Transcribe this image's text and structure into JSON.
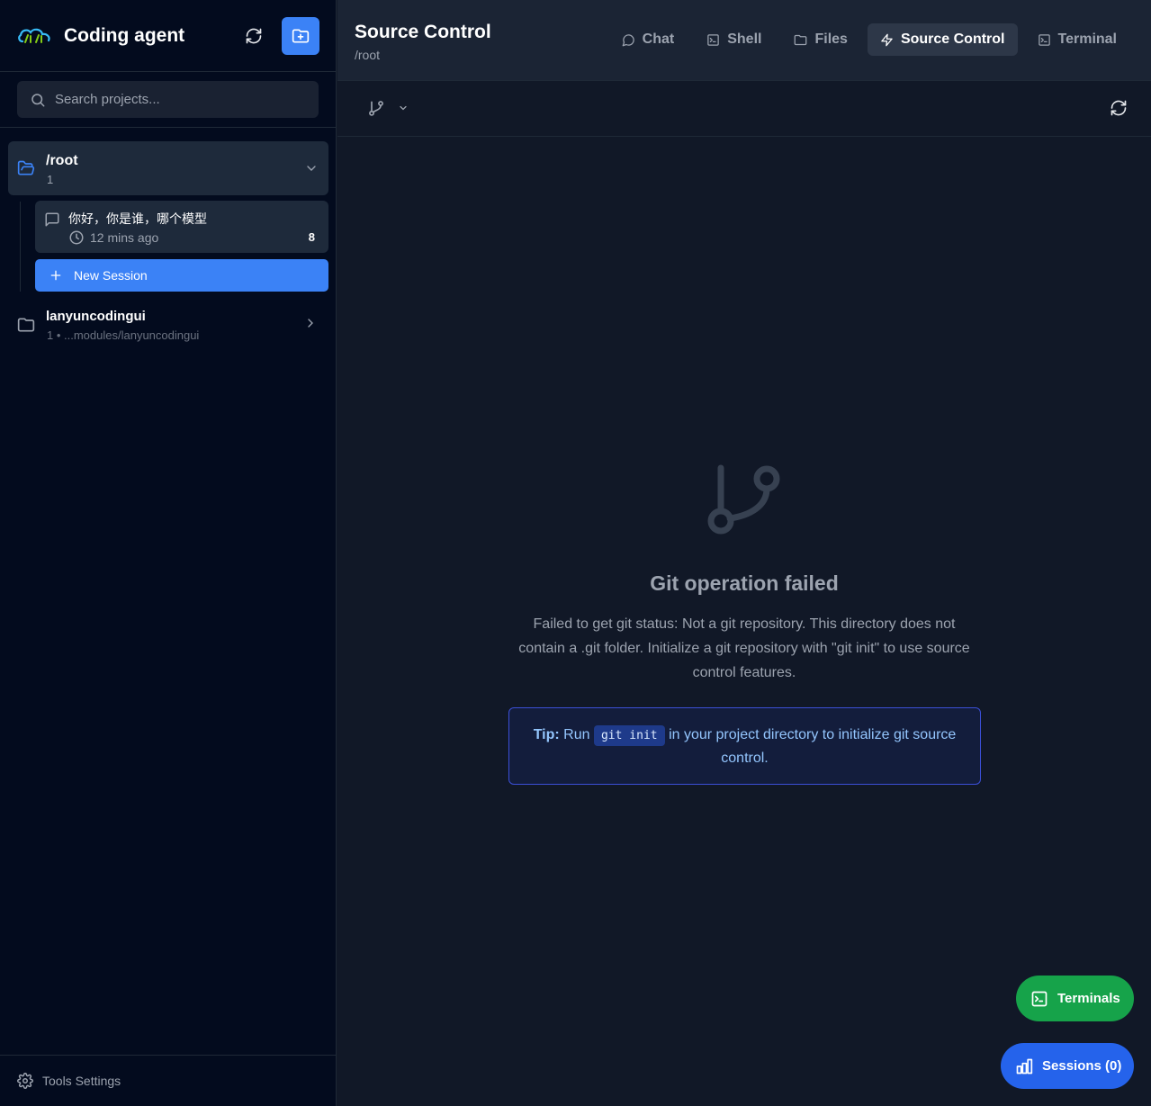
{
  "sidebar": {
    "brand": "Coding agent",
    "search_placeholder": "Search projects...",
    "projects": [
      {
        "name": "/root",
        "count": "1",
        "expanded": true,
        "sessions": [
          {
            "title": "你好，你是谁，哪个模型",
            "time": "12 mins ago",
            "badge": "8"
          }
        ],
        "new_session_label": "New Session"
      },
      {
        "name": "lanyuncodingui",
        "meta": "1 • ...modules/lanyuncodingui",
        "expanded": false
      }
    ],
    "footer_label": "Tools Settings"
  },
  "header": {
    "title": "Source Control",
    "path": "/root",
    "tabs": [
      {
        "label": "Chat",
        "icon": "chat-bubble-icon",
        "active": false
      },
      {
        "label": "Shell",
        "icon": "terminal-square-icon",
        "active": false
      },
      {
        "label": "Files",
        "icon": "folder-icon",
        "active": false
      },
      {
        "label": "Source Control",
        "icon": "lightning-icon",
        "active": true
      },
      {
        "label": "Terminal",
        "icon": "terminal-square-icon",
        "active": false
      }
    ]
  },
  "source_control": {
    "error_title": "Git operation failed",
    "error_message": "Failed to get git status: Not a git repository. This directory does not contain a .git folder. Initialize a git repository with \"git init\" to use source control features.",
    "tip": {
      "label": "Tip:",
      "before": "Run",
      "code": "git init",
      "after": "in your project directory to initialize git source control."
    }
  },
  "fabs": {
    "terminals_label": "Terminals",
    "sessions_label": "Sessions (0)"
  },
  "colors": {
    "accent": "#3b82f6",
    "sidebar_bg": "#030b1e",
    "main_bg": "#111827",
    "terminals_green": "#16a34a",
    "sessions_blue": "#2563eb"
  }
}
